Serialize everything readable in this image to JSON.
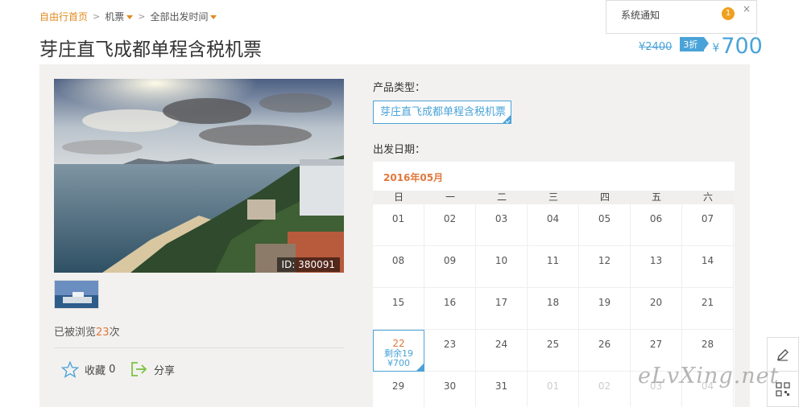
{
  "breadcrumb": {
    "home": "自由行首页",
    "sep": ">",
    "cat": "机票",
    "time": "全部出发时间"
  },
  "title": "芽庄直飞成都单程含税机票",
  "notice": {
    "text": "系统通知",
    "count": "1",
    "close": "×"
  },
  "price": {
    "old": "¥2400",
    "discount": "3折",
    "currency": "¥",
    "now": "700"
  },
  "gallery": {
    "photo_id": "ID: 380091"
  },
  "views": {
    "prefix": "已被浏览",
    "count": "23",
    "suffix": "次"
  },
  "actions": {
    "fav_label": "收藏",
    "fav_count": "0",
    "share_label": "分享"
  },
  "product": {
    "type_label": "产品类型：",
    "type_value": "芽庄直飞成都单程含税机票",
    "date_label": "出发日期："
  },
  "calendar": {
    "month": "2016年05月",
    "weekdays": [
      "日",
      "一",
      "二",
      "三",
      "四",
      "五",
      "六"
    ],
    "rows": [
      [
        "01",
        "02",
        "03",
        "04",
        "05",
        "06",
        "07"
      ],
      [
        "08",
        "09",
        "10",
        "11",
        "12",
        "13",
        "14"
      ],
      [
        "15",
        "16",
        "17",
        "18",
        "19",
        "20",
        "21"
      ],
      [
        "22",
        "23",
        "24",
        "25",
        "26",
        "27",
        "28"
      ],
      [
        "29",
        "30",
        "31",
        "01",
        "02",
        "03",
        "04"
      ]
    ],
    "dim_next": [
      "01",
      "02",
      "03",
      "04"
    ],
    "selected": {
      "day": "22",
      "remaining": "剩余19",
      "price": "¥700"
    }
  },
  "watermark": "eLvXing.net",
  "icons": {
    "star": "star-icon",
    "share": "share-icon",
    "pen": "pen-icon",
    "qr": "qr-icon"
  },
  "colors": {
    "accent": "#4aa3d8",
    "orange": "#e0783b",
    "panel": "#f2f1ef"
  }
}
